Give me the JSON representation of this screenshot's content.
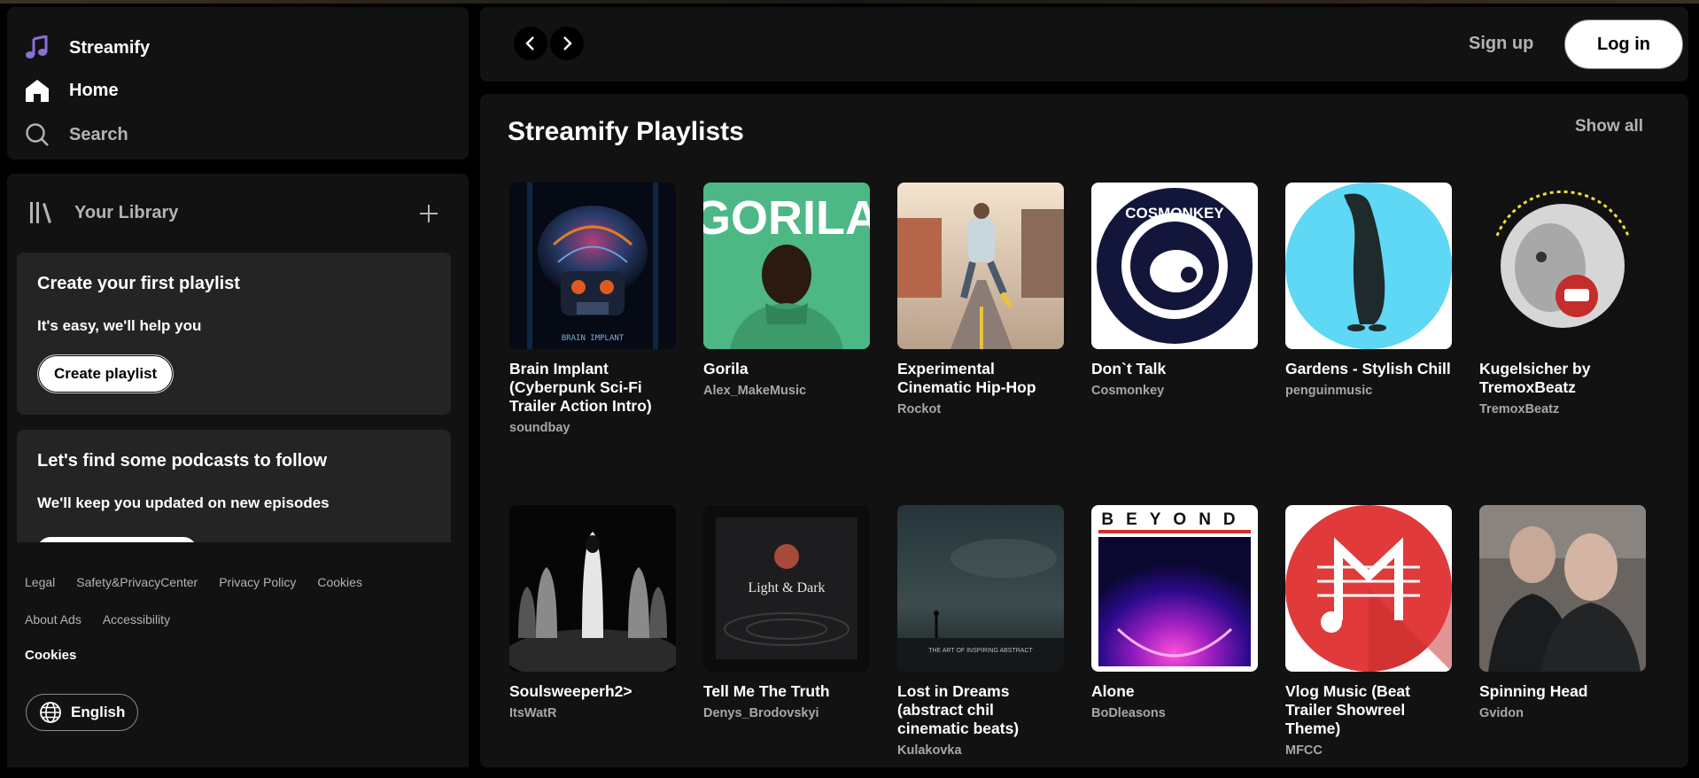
{
  "nav": {
    "brand": "Streamify",
    "home": "Home",
    "search": "Search"
  },
  "library": {
    "title": "Your Library",
    "card1": {
      "title": "Create your first playlist",
      "subtitle": "It's easy, we'll help you",
      "button": "Create playlist"
    },
    "card2": {
      "title": "Let's find some podcasts to follow",
      "subtitle": "We'll keep you updated on new episodes"
    }
  },
  "footer": {
    "links_row1": [
      "Legal",
      "Safety&PrivacyCenter",
      "Privacy Policy",
      "Cookies"
    ],
    "links_row2": [
      "About Ads",
      "Accessibility"
    ],
    "cookies": "Cookies",
    "language": "English"
  },
  "topbar": {
    "signup": "Sign up",
    "login": "Log in"
  },
  "section": {
    "title": "Streamify Playlists",
    "show_all": "Show all"
  },
  "playlists": [
    {
      "title": "Brain Implant (Cyberpunk Sci-Fi Trailer Action Intro)",
      "artist": "soundbay",
      "cover_text": "BRAIN IMPLANT"
    },
    {
      "title": "Gorila",
      "artist": "Alex_MakeMusic",
      "cover_text": "GORILA"
    },
    {
      "title": "Experimental Cinematic Hip-Hop",
      "artist": "Rockot"
    },
    {
      "title": "Don`t Talk",
      "artist": "Cosmonkey",
      "cover_text": "COSMONKEY"
    },
    {
      "title": "Gardens - Stylish Chill",
      "artist": "penguinmusic"
    },
    {
      "title": "Kugelsicher by TremoxBeatz",
      "artist": "TremoxBeatz"
    },
    {
      "title": "Soulsweeperh2>",
      "artist": "ItsWatR"
    },
    {
      "title": "Tell Me The Truth",
      "artist": "Denys_Brodovskyi",
      "cover_text": "Light & Dark"
    },
    {
      "title": "Lost in Dreams (abstract chil cinematic beats)",
      "artist": "Kulakovka",
      "cover_text": "THE ART OF INSPIRING ABSTRACT"
    },
    {
      "title": "Alone",
      "artist": "BoDleasons",
      "cover_text": "BEYOND"
    },
    {
      "title": "Vlog Music (Beat Trailer Showreel Theme)",
      "artist": "MFCC"
    },
    {
      "title": "Spinning Head",
      "artist": "Gvidon"
    }
  ],
  "colors": {
    "panel": "#121212",
    "card": "#242424",
    "muted_text": "#b3b3b3",
    "brand_icon": "#8b6fd6"
  }
}
